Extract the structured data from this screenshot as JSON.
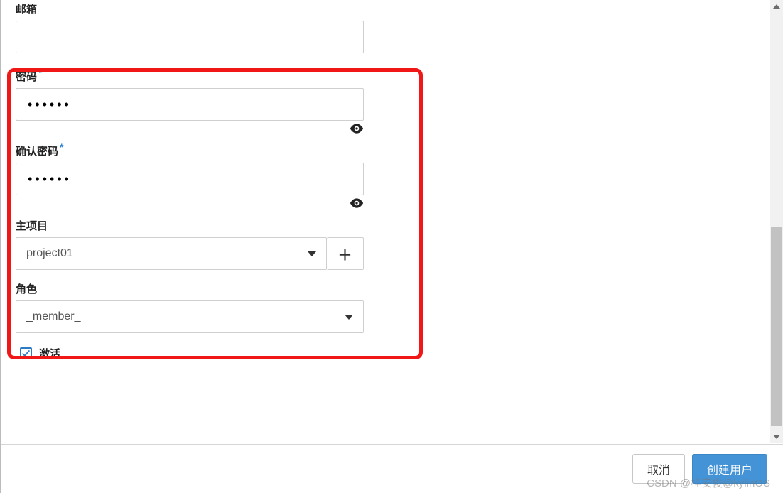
{
  "form": {
    "email": {
      "label": "邮箱",
      "value": ""
    },
    "password": {
      "label": "密码",
      "value": "••••••",
      "masked": "••••••"
    },
    "confirm_password": {
      "label": "确认密码",
      "value": "••••••",
      "masked": "••••••"
    },
    "main_project": {
      "label": "主项目",
      "selected": "project01"
    },
    "role": {
      "label": "角色",
      "selected": "_member_"
    },
    "active": {
      "label": "激活",
      "checked": true
    }
  },
  "footer": {
    "cancel": "取消",
    "submit": "创建用户"
  },
  "watermark": "CSDN @桂安俊@kylinOS"
}
